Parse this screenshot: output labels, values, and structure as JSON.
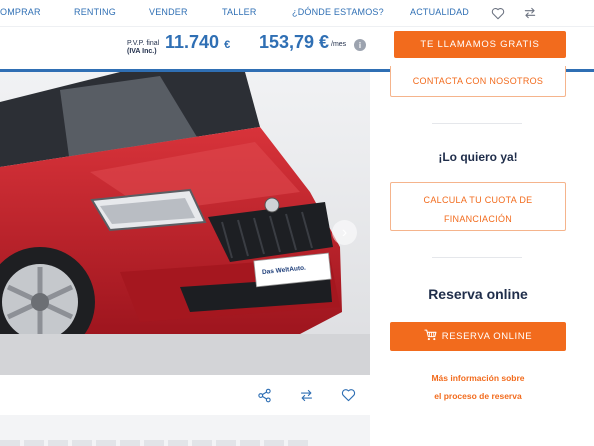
{
  "nav": {
    "items": [
      "OMPRAR",
      "RENTING",
      "VENDER",
      "TALLER",
      "¿DÓNDE ESTAMOS?",
      "ACTUALIDAD"
    ],
    "icons": [
      "heart-icon",
      "compare-icon"
    ]
  },
  "price": {
    "pvp_label_1": "P.V.P. final",
    "pvp_label_2": "(IVA Inc.)",
    "pvp_value": "11.740",
    "pvp_currency": "€",
    "monthly_value": "153,79 €",
    "monthly_unit": "/mes",
    "info": "i",
    "call_button": "TE LLAMAMOS GRATIS"
  },
  "photo": {
    "dealer_logo_text": "Das WeltAuto."
  },
  "actions": {
    "icons": [
      "share-icon",
      "compare-icon",
      "heart-icon"
    ]
  },
  "sidebar": {
    "contact_button": "CONTACTA CON NOSOTROS",
    "want_it_heading": "¡Lo quiero ya!",
    "finance_line_1": "CALCULA TU CUOTA DE",
    "finance_line_2": "FINANCIACIÓN",
    "reserve_heading": "Reserva online",
    "reserve_button": "RESERVA ONLINE",
    "more_info_1": "Más información sobre",
    "more_info_2": "el proceso de reserva"
  },
  "colors": {
    "brand_blue": "#2f6fb4",
    "accent_orange": "#f26b1d",
    "car_red": "#c8202b"
  }
}
